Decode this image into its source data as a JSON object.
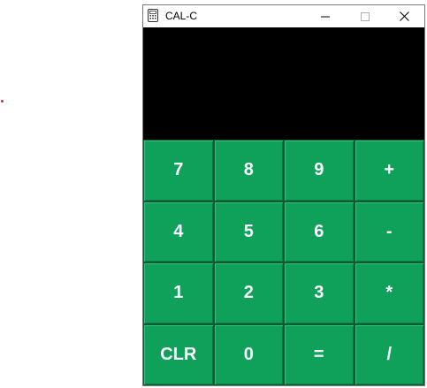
{
  "window": {
    "title": "CAL-C",
    "icon": "calculator-icon",
    "controls": [
      "minimize-icon",
      "maximize-icon",
      "close-icon"
    ]
  },
  "display": {
    "value": ""
  },
  "keys": [
    "7",
    "8",
    "9",
    "+",
    "4",
    "5",
    "6",
    "-",
    "1",
    "2",
    "3",
    "*",
    "CLR",
    "0",
    "=",
    "/"
  ],
  "colors": {
    "key_bg": "#0fa15a",
    "key_text": "#ffffff",
    "display_bg": "#000000"
  }
}
